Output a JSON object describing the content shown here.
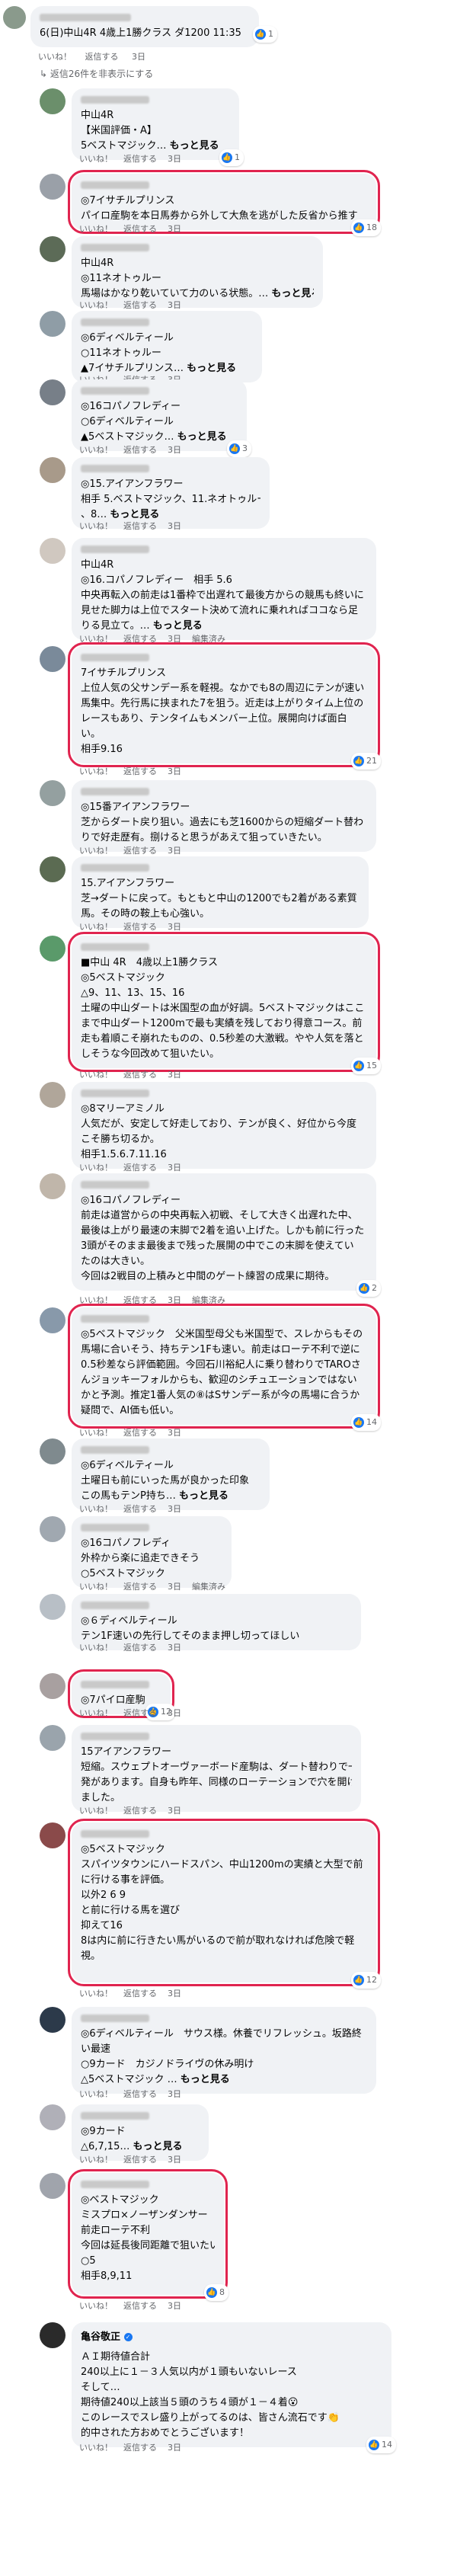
{
  "header": {
    "text": "6(日)中山4R 4歳上1勝クラス ダ1200 11:35",
    "likes": "1",
    "actions": [
      "いいね！",
      "返信する",
      "3日"
    ]
  },
  "toggle_label": "返信26件を非表示にする",
  "action_labels": {
    "like": "いいね！",
    "reply": "返信する",
    "edit": "編集済み",
    "time": "3日"
  },
  "comments": [
    {
      "lines": [
        "中山4R",
        "【米国評価・A】",
        "5ベストマジック… もっと見る"
      ],
      "likes": "1"
    },
    {
      "lines": [
        "◎7イサチルプリンス",
        "パイロ産駒を本日馬券から外して大魚を逃がした反省から推す"
      ],
      "likes": "18"
    },
    {
      "lines": [
        "中山4R",
        "◎11ネオトゥルー",
        "馬場はかなり乾いていて力のいる状態。… もっと見る"
      ],
      "likes": ""
    },
    {
      "lines": [
        "◎6ディベルティール",
        "○11ネオトゥルー",
        "▲7イサチルプリンス… もっと見る"
      ],
      "likes": ""
    },
    {
      "lines": [
        "◎16コパノフレディー",
        "○6ディベルティール",
        "▲5ベストマジック… もっと見る"
      ],
      "likes": "3"
    },
    {
      "lines": [
        "◎15.アイアンフラワー",
        "相手 5.ベストマジック、11.ネオトゥルー",
        "、8… もっと見る"
      ],
      "likes": ""
    },
    {
      "lines": [
        "中山4R",
        "◎16.コパノフレディー　相手 5.6",
        "中央再転入の前走は1番枠で出遅れて最後方からの競馬も終いに",
        "見せた脚力は上位でスタート決めて流れに乗れればココなら足",
        "りる見立て。… もっと見る"
      ],
      "likes": ""
    },
    {
      "lines": [
        "7イサチルプリンス",
        "上位人気の父サンデー系を軽視。なかでも8の周辺にテンが速い",
        "馬集中。先行馬に挟まれた7を狙う。近走は上がりタイム上位の",
        "レースもあり、テンタイムもメンバー上位。展開向けば面白",
        "い。",
        "相手9.16"
      ],
      "likes": "21"
    },
    {
      "lines": [
        "◎15番アイアンフラワー",
        "芝からダート戻り狙い。過去にも芝1600からの短縮ダート替わ",
        "りで好走歴有。捌けると思うがあえて狙っていきたい。"
      ],
      "likes": ""
    },
    {
      "lines": [
        "15.アイアンフラワー",
        "芝→ダートに戻って。もともと中山の1200でも2着がある素質",
        "馬。その時の鞍上も心強い。"
      ],
      "likes": ""
    },
    {
      "lines": [
        "■中山 4R　4歳以上1勝クラス",
        "◎5ベストマジック",
        "△9、11、13、15、16",
        "土曜の中山ダートは米国型の血が好調。5ベストマジックはここ",
        "まで中山ダート1200mで最も実績を残しており得意コース。前",
        "走も着順こそ崩れたものの、0.5秒差の大激戦。やや人気を落と",
        "しそうな今回改めて狙いたい。"
      ],
      "likes": "15"
    },
    {
      "lines": [
        "◎8マリーアミノル",
        "人気だが、安定して好走しており、テンが良く、好位から今度",
        "こそ勝ち切るか。",
        "相手1.5.6.7.11.16"
      ],
      "likes": ""
    },
    {
      "lines": [
        "◎16コパノフレディー",
        "前走は道営からの中央再転入初戦、そして大きく出遅れた中、",
        "最後は上がり最速の末脚で2着を追い上げた。しかも前に行った",
        "3頭がそのまま最後まで残った展開の中でこの末脚を使えてい",
        "たのは大きい。",
        "今回は2戦目の上積みと中間のゲート練習の成果に期待。"
      ],
      "likes": "2"
    },
    {
      "lines": [
        "◎5ベストマジック　父米国型母父も米国型で、スレからもその",
        "馬場に合いそう、持ちテン1Fも速い。前走はローテ不利で逆に",
        "0.5秒差なら評価範囲。今回石川裕紀人に乗り替わりでTAROさ",
        "んジョッキーフォルからも、歓迎のシチュエーションではない",
        "かと予測。推定1番人気の⑧はSサンデー系が今の馬場に合うか",
        "疑問で、AI価も低い。"
      ],
      "likes": "14"
    },
    {
      "lines": [
        "◎6ディベルティール",
        "土曜日も前にいった馬が良かった印象",
        "この馬もテンP持ち… もっと見る"
      ],
      "likes": ""
    },
    {
      "lines": [
        "◎16コパノフレディ",
        "外枠から楽に追走できそう",
        "○5ベストマジック"
      ],
      "likes": ""
    },
    {
      "lines": [
        "◎６ディベルティール",
        "テン1F速いの先行してそのまま押し切ってほしい"
      ],
      "likes": ""
    },
    {
      "lines": [
        "◎7パイロ産駒"
      ],
      "likes": "12"
    },
    {
      "lines": [
        "15アイアンフラワー",
        "短縮。スウェプトオーヴァーボード産駒は、ダート替わりで一",
        "発があります。自身も昨年、同様のローテーションで穴を開け",
        "ました。"
      ],
      "likes": ""
    },
    {
      "lines": [
        "◎5ベストマジック",
        "スパイツタウンにハードスパン、中山1200mの実績と大型で前",
        "に行ける事を評価。",
        "以外2 6 9",
        "と前に行ける馬を選び",
        "抑えて16",
        "8は内に前に行きたい馬がいるので前が取れなければ危険で軽",
        "視。"
      ],
      "likes": "12"
    },
    {
      "lines": [
        "◎6ディベルティール　サウス様。休養でリフレッシュ。坂路終",
        "い最速",
        "○9カード　カジノドライヴの休み明け",
        "△5ベストマジック … もっと見る"
      ],
      "likes": ""
    },
    {
      "lines": [
        "◎9カード",
        "△6,7,15… もっと見る"
      ],
      "likes": ""
    },
    {
      "lines": [
        "◎ベストマジック",
        "ミスプロ×ノーザンダンサー",
        "前走ローテ不利",
        "今回は延長後同距離で狙いたいです！",
        "○5",
        "相手8,9,11"
      ],
      "likes": "8"
    },
    {
      "lines": [
        "ＡＩ期待値合計",
        "240以上に１－３人気以内が１頭もいないレース",
        "そして…",
        "期待値240以上該当５頭のうち４頭が１－４着😮",
        "このレースでスレ盛り上がってるのは、皆さん流石です👏",
        "的中された方おめでとうございます！"
      ],
      "likes": "14",
      "author": "亀谷敬正"
    }
  ]
}
